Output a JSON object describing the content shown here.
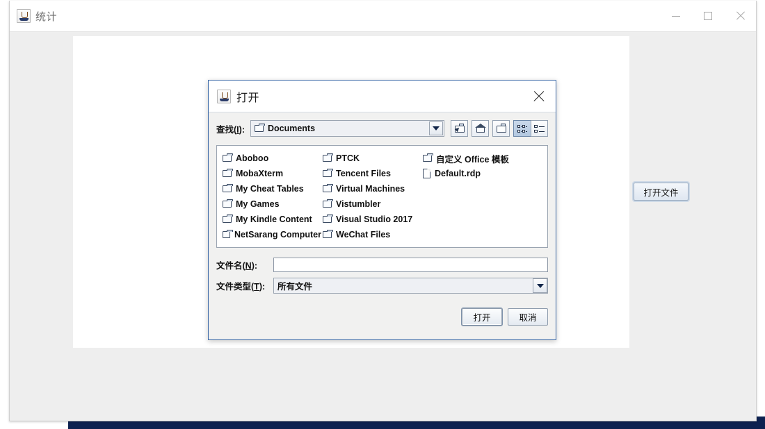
{
  "app_window": {
    "title": "统计",
    "icon": "java-coffee-cup-icon",
    "controls": {
      "minimize": "minimize-icon",
      "maximize": "maximize-icon",
      "close": "close-icon"
    },
    "open_file_button": "打开文件"
  },
  "dialog": {
    "title": "打开",
    "icon": "java-coffee-cup-icon",
    "close_icon": "close-icon",
    "lookin": {
      "label": "查找(",
      "mnemonic": "I",
      "label_suffix": "):",
      "value": "Documents",
      "value_icon": "folder-icon",
      "dropdown_icon": "chevron-down-icon"
    },
    "toolbar": [
      {
        "name": "up-one-level-button",
        "icon": "folder-up-arrow-icon",
        "pressed": false
      },
      {
        "name": "home-button",
        "icon": "home-icon",
        "pressed": false
      },
      {
        "name": "create-new-folder-button",
        "icon": "new-folder-icon",
        "pressed": false
      },
      {
        "name": "grid-view-toggle",
        "icon": "grid-view-icon",
        "pressed": true
      },
      {
        "name": "list-view-toggle",
        "icon": "list-view-icon",
        "pressed": false
      }
    ],
    "files": [
      {
        "name": "Aboboo",
        "type": "folder"
      },
      {
        "name": "MobaXterm",
        "type": "folder"
      },
      {
        "name": "My Cheat Tables",
        "type": "folder"
      },
      {
        "name": "My Games",
        "type": "folder"
      },
      {
        "name": "My Kindle Content",
        "type": "folder"
      },
      {
        "name": "NetSarang Computer",
        "type": "folder"
      },
      {
        "name": "PTCK",
        "type": "folder"
      },
      {
        "name": "Tencent Files",
        "type": "folder"
      },
      {
        "name": "Virtual Machines",
        "type": "folder"
      },
      {
        "name": "Vistumbler",
        "type": "folder"
      },
      {
        "name": "Visual Studio 2017",
        "type": "folder"
      },
      {
        "name": "WeChat Files",
        "type": "folder"
      },
      {
        "name": "自定义 Office 模板",
        "type": "folder"
      },
      {
        "name": "Default.rdp",
        "type": "file"
      }
    ],
    "filename_field": {
      "label": "文件名(",
      "mnemonic": "N",
      "label_suffix": "):",
      "value": "",
      "placeholder": ""
    },
    "filetype_field": {
      "label": "文件类型(",
      "mnemonic": "T",
      "label_suffix": "):",
      "value": "所有文件",
      "dropdown_icon": "chevron-down-icon"
    },
    "buttons": {
      "open": "打开",
      "cancel": "取消"
    }
  },
  "colors": {
    "dialog_border": "#3d6aa8",
    "desktop_strip": "#0d2150",
    "window_bg": "#eeeeee",
    "accent_pressed": "#b3c8e0"
  }
}
